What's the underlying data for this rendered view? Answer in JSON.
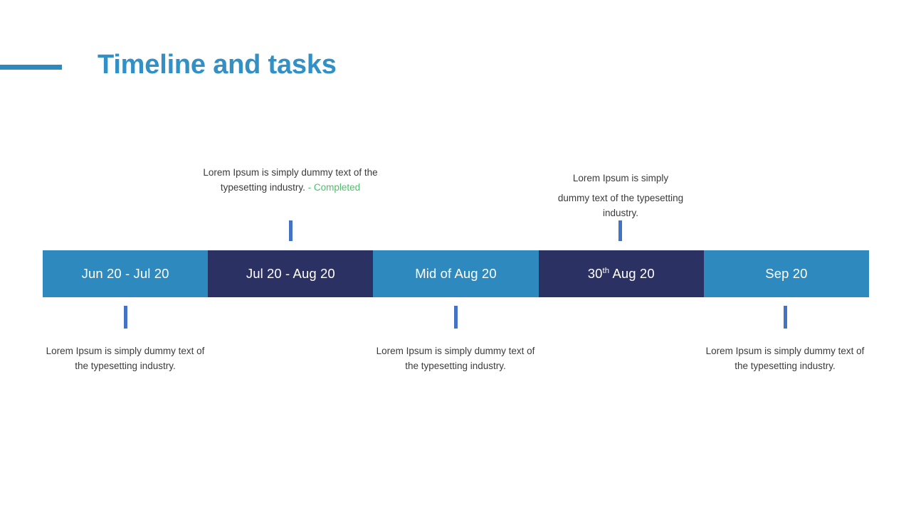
{
  "slide": {
    "title": "Timeline and tasks",
    "accent_color": "#2e89bf",
    "title_color": "#3290c4"
  },
  "timeline": {
    "segment_light_color": "#2e89bf",
    "segment_dark_color": "#2b3162",
    "tick_color": "#4472c4",
    "segments": [
      {
        "label": "Jun 20 - Jul 20",
        "style": "light"
      },
      {
        "label": "Jul 20 - Aug 20",
        "style": "dark"
      },
      {
        "label": "Mid of Aug 20",
        "style": "light"
      },
      {
        "label_prefix": "30",
        "label_sup": "th",
        "label_suffix": " Aug 20",
        "style": "dark"
      },
      {
        "label": "Sep 20",
        "style": "light"
      }
    ]
  },
  "notes": {
    "above": [
      {
        "segment": 2,
        "line1": "Lorem Ipsum is simply dummy text of",
        "line2": "the typesetting industry.",
        "status": "- Completed",
        "status_color": "#4cc06a"
      },
      {
        "segment": 4,
        "line1": "Lorem Ipsum is simply",
        "line2": "dummy text of the typesetting",
        "line3": "industry."
      }
    ],
    "below": [
      {
        "segment": 1,
        "line1": "Lorem Ipsum is simply dummy",
        "line2": "text of the typesetting industry."
      },
      {
        "segment": 3,
        "line1": "Lorem Ipsum is simply dummy",
        "line2": "text of the typesetting industry."
      },
      {
        "segment": 5,
        "line1": "Lorem Ipsum is simply dummy",
        "line2": "text of the typesetting industry."
      }
    ]
  }
}
